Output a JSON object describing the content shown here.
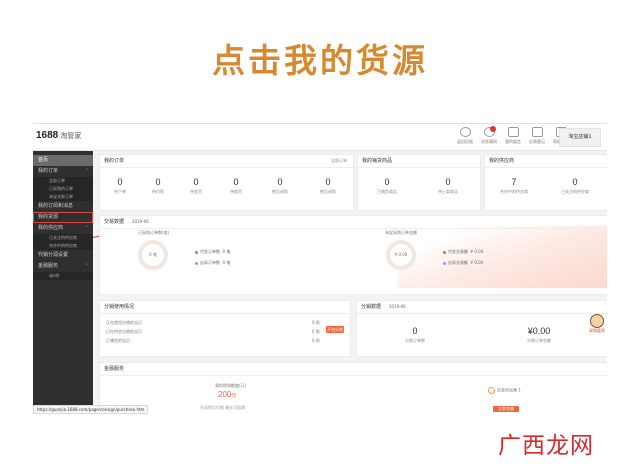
{
  "slide_title": "点击我的货源",
  "watermark": "广西龙网",
  "app": {
    "logo_main": "1688",
    "logo_sub": "淘管家"
  },
  "topbar": {
    "icons": [
      {
        "icon": "return-icon",
        "label": "返回旧版"
      },
      {
        "icon": "message-icon",
        "label": "消息通知"
      },
      {
        "icon": "mail-icon",
        "label": "我的留言"
      },
      {
        "icon": "feedback-icon",
        "label": "反馈意见"
      },
      {
        "icon": "help-icon",
        "label": "帮助中心"
      }
    ],
    "user": "淘宝店铺1"
  },
  "sidebar": {
    "items": [
      {
        "label": "首页"
      },
      {
        "label": "我的订单"
      },
      {
        "label": "全部订单"
      },
      {
        "label": "已采购的订单"
      },
      {
        "label": "淘宝关联订单"
      },
      {
        "label": "我的订阅和消息"
      },
      {
        "label": "我的货源"
      },
      {
        "label": "我的供应商"
      },
      {
        "label": "已关注的供应商"
      },
      {
        "label": "合作中的供应商"
      },
      {
        "label": "代销分润设置"
      },
      {
        "label": "金融服务"
      },
      {
        "label": "诚e赊"
      }
    ]
  },
  "orders": {
    "title": "我的订单",
    "link": "全部订单",
    "stats": [
      {
        "value": "0",
        "label": "待下单"
      },
      {
        "value": "0",
        "label": "待付款"
      },
      {
        "value": "0",
        "label": "待发货"
      },
      {
        "value": "0",
        "label": "待收货"
      },
      {
        "value": "0",
        "label": "售后退款"
      },
      {
        "value": "0",
        "label": "售后退款"
      }
    ]
  },
  "products": {
    "title": "我的铺货商品",
    "stats": [
      {
        "value": "0",
        "label": "已铺货商品"
      },
      {
        "value": "0",
        "label": "待上架商品"
      }
    ]
  },
  "suppliers": {
    "title": "我的供应商",
    "stats": [
      {
        "value": "7",
        "label": "合作中的供应商"
      },
      {
        "value": "0",
        "label": "已关注的供应商"
      }
    ]
  },
  "trade": {
    "title": "交易数据",
    "period": "2019-06",
    "left_title": "已采购订单数(笔)",
    "left_value": "0 笔",
    "left_legend": [
      {
        "label": "代发订单数",
        "value": "0 笔"
      },
      {
        "label": "自采订单数",
        "value": "0 笔"
      }
    ],
    "right_title": "淘宝采购订单金额",
    "right_value": "¥ 0.00",
    "right_legend": [
      {
        "label": "代发交易额",
        "value": "¥ 0.00"
      },
      {
        "label": "自采交易额",
        "value": "¥ 0.00"
      }
    ]
  },
  "usage": {
    "title": "分销使用情况",
    "rows": [
      {
        "label": "正在使用分销的宝贝",
        "value": "0 款"
      },
      {
        "label": "已在供货分销的宝贝",
        "value": "0 款"
      },
      {
        "label": "已铺货的宝贝",
        "value": "0 款"
      }
    ],
    "button": "开启分销"
  },
  "dist": {
    "title": "分销数据",
    "period": "2019-06",
    "stats": [
      {
        "value": "0",
        "label": "分销订单数"
      },
      {
        "value": "¥0.00",
        "label": "分销订单金额"
      }
    ]
  },
  "finance": {
    "title": "金融服务",
    "credit_label": "我的赊购额度(元)",
    "credit_value": "200",
    "credit_unit": "元",
    "credit_note": "先采购后付款 最长可延期",
    "right_label": "信息待完善 1",
    "right_button": "立即完善"
  },
  "status_url": "https://guanjia.1688.com/page/consign/purchase.htm",
  "float_ad": "采购管家"
}
